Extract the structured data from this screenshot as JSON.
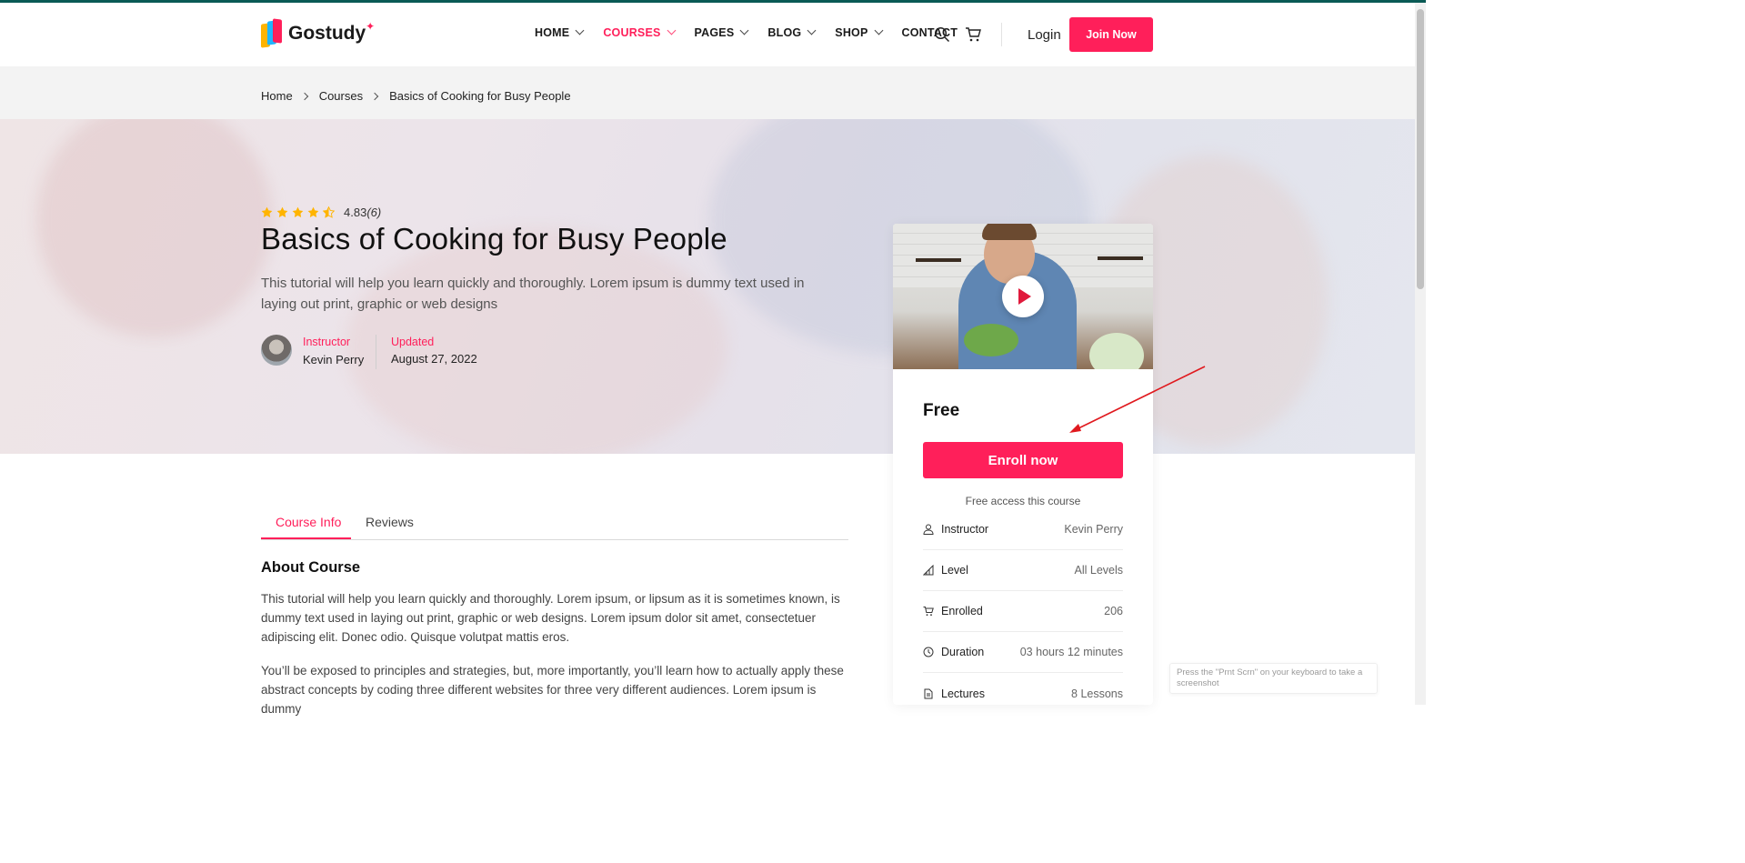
{
  "brand": {
    "name": "Gostudy",
    "accent": "#ff1f5a"
  },
  "nav": {
    "items": [
      {
        "label": "HOME",
        "dropdown": true
      },
      {
        "label": "COURSES",
        "dropdown": true,
        "active": true
      },
      {
        "label": "PAGES",
        "dropdown": true
      },
      {
        "label": "BLOG",
        "dropdown": true
      },
      {
        "label": "SHOP",
        "dropdown": true
      },
      {
        "label": "CONTACT",
        "dropdown": false
      }
    ],
    "login": "Login",
    "join": "Join Now"
  },
  "breadcrumb": [
    "Home",
    "Courses",
    "Basics of Cooking for Busy People"
  ],
  "hero": {
    "rating_value": "4.83",
    "rating_count": "(6)",
    "rating_stars": 4.5,
    "title": "Basics of Cooking for Busy People",
    "description": "This tutorial will help you learn quickly and thoroughly. Lorem ipsum is dummy text used in laying out print, graphic or web designs",
    "instructor_label": "Instructor",
    "instructor_name": "Kevin Perry",
    "updated_label": "Updated",
    "updated_date": "August 27, 2022"
  },
  "card": {
    "price": "Free",
    "enroll": "Enroll now",
    "free_access": "Free access this course",
    "rows": [
      {
        "icon": "user-icon",
        "label": "Instructor",
        "value": "Kevin Perry"
      },
      {
        "icon": "level-icon",
        "label": "Level",
        "value": "All Levels"
      },
      {
        "icon": "cart-icon",
        "label": "Enrolled",
        "value": "206"
      },
      {
        "icon": "clock-icon",
        "label": "Duration",
        "value": "03 hours 12 minutes"
      },
      {
        "icon": "document-icon",
        "label": "Lectures",
        "value": "8 Lessons"
      }
    ]
  },
  "tabs": [
    "Course Info",
    "Reviews"
  ],
  "about": {
    "heading": "About Course",
    "p1": "This tutorial will help you learn quickly and thoroughly. Lorem ipsum, or lipsum as it is sometimes known, is dummy text used in laying out print, graphic or web designs. Lorem ipsum dolor sit amet, consectetuer adipiscing elit. Donec odio. Quisque volutpat mattis eros.",
    "p2": "You’ll be exposed to principles and strategies, but, more importantly, you’ll learn how to actually apply these abstract concepts by coding three different websites for three very different audiences. Lorem ipsum is dummy"
  },
  "toast": "Press the \"Prnt Scrn\" on your keyboard to take a screenshot"
}
